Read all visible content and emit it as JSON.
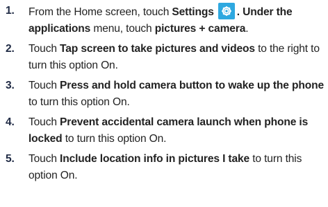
{
  "steps": [
    {
      "number": "1.",
      "parts": [
        "From the Home screen, touch ",
        "Settings",
        ". Under the ",
        "applications",
        " menu, touch ",
        "pictures + camera",
        "."
      ],
      "icon": "gear-icon"
    },
    {
      "number": "2.",
      "parts": [
        "Touch ",
        "Tap screen to take pictures and videos",
        " to the right to turn this option On."
      ]
    },
    {
      "number": "3.",
      "parts": [
        "Touch ",
        "Press and hold camera button to wake up the phone",
        " to turn this option On."
      ]
    },
    {
      "number": "4.",
      "parts": [
        "Touch ",
        "Prevent accidental camera launch when phone is locked",
        " to turn this option On."
      ]
    },
    {
      "number": "5.",
      "parts": [
        "Touch ",
        "Include location info in pictures I take",
        " to turn this option On."
      ]
    }
  ],
  "colors": {
    "icon_bg": "#2ea8e0",
    "text": "#222222"
  }
}
